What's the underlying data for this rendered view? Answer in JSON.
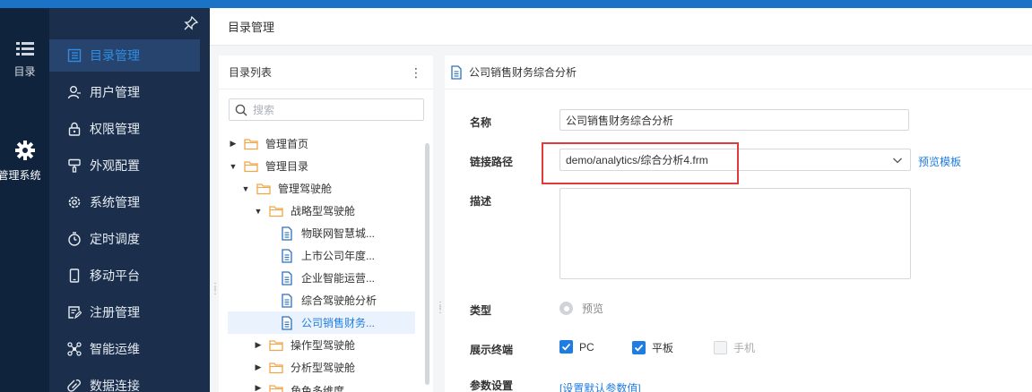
{
  "rail": {
    "catalog_label": "目录",
    "system_label": "管理系统"
  },
  "nav": {
    "items": [
      {
        "label": "目录管理",
        "icon": "list-icon"
      },
      {
        "label": "用户管理",
        "icon": "user-icon"
      },
      {
        "label": "权限管理",
        "icon": "lock-icon"
      },
      {
        "label": "外观配置",
        "icon": "brush-icon"
      },
      {
        "label": "系统管理",
        "icon": "gear-icon"
      },
      {
        "label": "定时调度",
        "icon": "timer-icon"
      },
      {
        "label": "移动平台",
        "icon": "mobile-icon"
      },
      {
        "label": "注册管理",
        "icon": "register-icon"
      },
      {
        "label": "智能运维",
        "icon": "ops-icon"
      },
      {
        "label": "数据连接",
        "icon": "link-icon"
      }
    ],
    "active_index": 0
  },
  "breadcrumb": {
    "title": "目录管理"
  },
  "tree": {
    "title": "目录列表",
    "search_placeholder": "搜索",
    "rows": [
      {
        "label": "管理首页"
      },
      {
        "label": "管理目录"
      },
      {
        "label": "管理驾驶舱"
      },
      {
        "label": "战略型驾驶舱"
      },
      {
        "label": "物联网智慧城..."
      },
      {
        "label": "上市公司年度..."
      },
      {
        "label": "企业智能运营..."
      },
      {
        "label": "综合驾驶舱分析"
      },
      {
        "label": "公司销售财务..."
      },
      {
        "label": "操作型驾驶舱"
      },
      {
        "label": "分析型驾驶舱"
      },
      {
        "label": "角色多维度"
      }
    ]
  },
  "detail": {
    "header_title": "公司销售财务综合分析",
    "name_label": "名称",
    "name_value": "公司销售财务综合分析",
    "path_label": "链接路径",
    "path_value": "demo/analytics/综合分析4.frm",
    "preview_template_link": "预览模板",
    "desc_label": "描述",
    "desc_value": "",
    "type_label": "类型",
    "type_option": "预览",
    "terminal_label": "展示终端",
    "terminals": [
      {
        "label": "PC",
        "checked": true
      },
      {
        "label": "平板",
        "checked": true
      },
      {
        "label": "手机",
        "checked": false
      }
    ],
    "param_label": "参数设置",
    "param_link": "[设置默认参数值]"
  },
  "colors": {
    "accent": "#1f7ce0",
    "nav_bg": "#1b2f4c",
    "rail_bg": "#10233d",
    "highlight_border": "#e03a3a",
    "folder": "#f0a64b"
  }
}
